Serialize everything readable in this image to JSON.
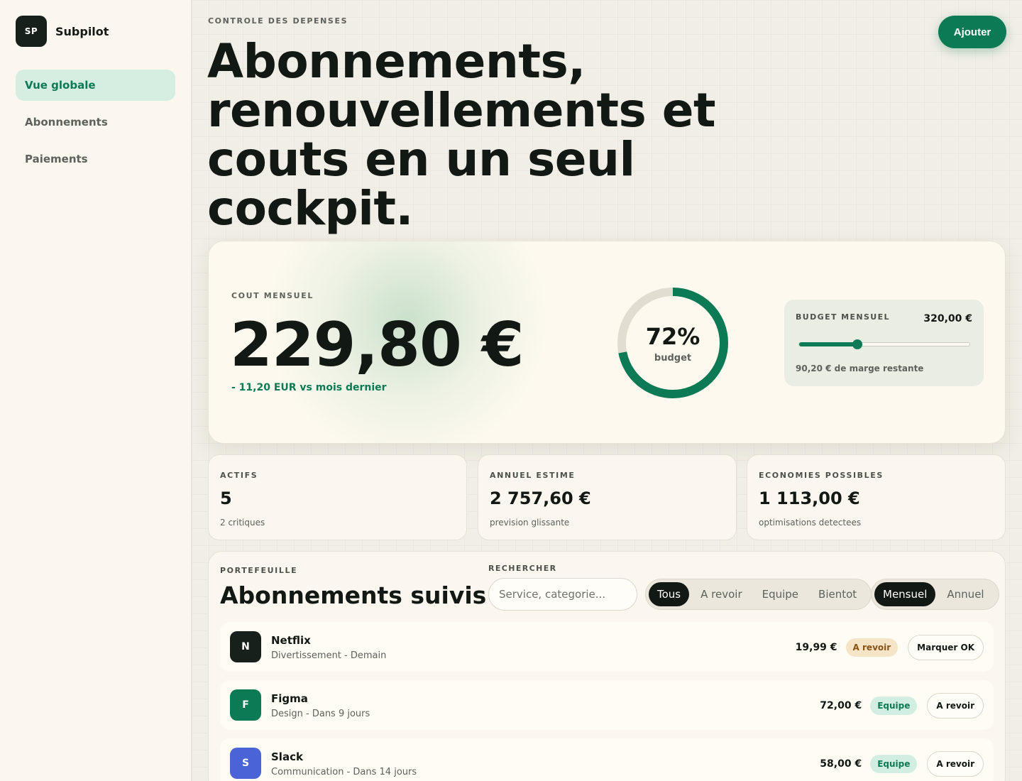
{
  "brand": {
    "logo": "SP",
    "name": "Subpilot"
  },
  "nav": [
    {
      "label": "Vue globale",
      "active": true
    },
    {
      "label": "Abonnements",
      "active": false
    },
    {
      "label": "Paiements",
      "active": false
    }
  ],
  "header": {
    "eyebrow": "CONTROLE DES DEPENSES",
    "title": "Abonnements, renouvellements et couts en un seul cockpit.",
    "add_label": "Ajouter"
  },
  "hero": {
    "cost_label": "COUT MENSUEL",
    "cost_value": "229,80 €",
    "delta": "- 11,20 EUR vs mois dernier",
    "ring_percent": "72%",
    "ring_fraction": 0.72,
    "ring_sub": "budget",
    "budget_label": "BUDGET MENSUEL",
    "budget_amount": "320,00 €",
    "budget_slider_fraction": 0.34,
    "budget_remaining": "90,20 € de marge restante"
  },
  "stats": [
    {
      "label": "ACTIFS",
      "value": "5",
      "sub": "2 critiques"
    },
    {
      "label": "ANNUEL ESTIME",
      "value": "2 757,60 €",
      "sub": "prevision glissante"
    },
    {
      "label": "ECONOMIES POSSIBLES",
      "value": "1 113,00 €",
      "sub": "optimisations detectees"
    }
  ],
  "portfolio": {
    "eyebrow": "PORTEFEUILLE",
    "title": "Abonnements suivis",
    "search_label": "RECHERCHER",
    "search_placeholder": "Service, categorie...",
    "filters": [
      "Tous",
      "A revoir",
      "Equipe",
      "Bientot"
    ],
    "periods": [
      "Mensuel",
      "Annuel"
    ],
    "rows": [
      {
        "initial": "N",
        "name": "Netflix",
        "meta": "Divertissement - Demain",
        "price": "19,99 €",
        "badge": "A revoir",
        "action": "Marquer OK",
        "color": "#17201b"
      },
      {
        "initial": "F",
        "name": "Figma",
        "meta": "Design - Dans 9 jours",
        "price": "72,00 €",
        "badge": "Equipe",
        "action": "A revoir",
        "color": "#0d7a56"
      },
      {
        "initial": "S",
        "name": "Slack",
        "meta": "Communication - Dans 14 jours",
        "price": "58,00 €",
        "badge": "Equipe",
        "action": "A revoir",
        "color": "#4a63d6"
      }
    ]
  },
  "colors": {
    "accent": "#0d7a56",
    "dark": "#121814",
    "review_badge": "#f6e4c7",
    "team_badge": "#d2eee2"
  }
}
